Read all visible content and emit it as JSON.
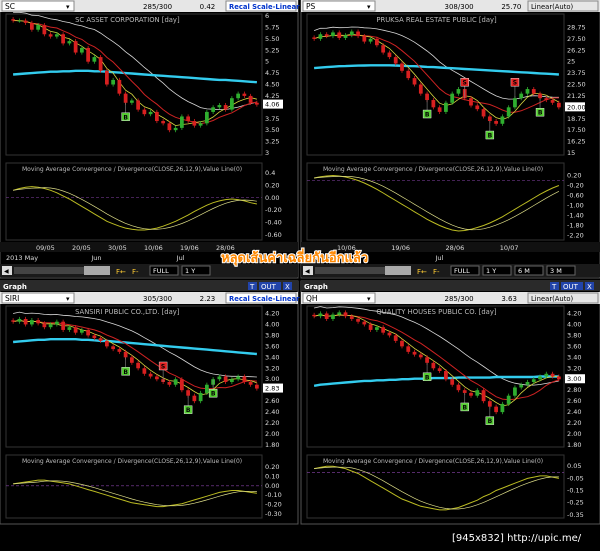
{
  "colors": {
    "background": "#000000",
    "header_bg": "#e6e6e6",
    "title_bar": "#2a2a2a",
    "recal_blue": "#0033cc",
    "grid": "#3a3a3a",
    "ma_slow": "#33ccee",
    "ma_white": "#d8d8d8",
    "ma_red": "#cc2222",
    "ma_yellow": "#d8d840",
    "candle_up": "#2fae2f",
    "candle_down": "#d82020",
    "buy_marker": "#55cc33",
    "sell_marker": "#dd2222",
    "macd_line": "#bbbb22",
    "macd_signal": "#dddd88",
    "overlay_text": "#ff8800"
  },
  "overlay_caption": "หลุดเส้นค่าเฉลี่ยกันอีกแล้ว",
  "footer": "[945x832] http://upic.me/",
  "charts": [
    {
      "symbol": "SC",
      "count": "285/300",
      "last": "0.42",
      "scale_label": "Recal Scale-Linear",
      "title": "SC ASSET CORPORATION [day]",
      "has_graph_bar": false,
      "price_ticks": [
        "6",
        "5.75",
        "5.50",
        "5.25",
        "5",
        "4.75",
        "4.50",
        "4.25",
        "4.06",
        "3.75",
        "3.50",
        "3.25",
        "3"
      ],
      "price_hl": "4.06",
      "macd_label": "Moving Average Convergence / Divergence(CLOSE,26,12,9),Value Line(0)",
      "macd_ticks": [
        "0.4",
        "0.20",
        "0.00",
        "-0.20",
        "-0.40",
        "-0.60"
      ],
      "date_ticks": [
        "09/05",
        "20/05",
        "30/05",
        "10/06",
        "19/06",
        "28/06"
      ],
      "month_labels": [
        "2013 May",
        "Jun",
        "Jul"
      ],
      "nav_buttons": [
        "FULL",
        "1 Y"
      ],
      "markers": [
        {
          "type": "B",
          "text": "B"
        }
      ],
      "chart_data": {
        "type": "line",
        "title": "SC ASSET CORPORATION [day]",
        "ylim": [
          3.0,
          6.0
        ],
        "close": [
          5.9,
          5.9,
          5.85,
          5.7,
          5.8,
          5.6,
          5.55,
          5.6,
          5.4,
          5.45,
          5.2,
          5.3,
          5.0,
          5.1,
          4.8,
          4.5,
          4.6,
          4.3,
          4.1,
          4.15,
          3.95,
          3.85,
          3.9,
          3.7,
          3.65,
          3.5,
          3.55,
          3.8,
          3.7,
          3.6,
          3.65,
          3.9,
          4.0,
          4.05,
          3.95,
          4.2,
          4.3,
          4.25,
          4.1,
          4.06
        ],
        "ma_slow": [
          4.72,
          4.73,
          4.74,
          4.75,
          4.76,
          4.77,
          4.78,
          4.78,
          4.79,
          4.79,
          4.8,
          4.8,
          4.8,
          4.79,
          4.79,
          4.78,
          4.77,
          4.76,
          4.75,
          4.74,
          4.73,
          4.72,
          4.71,
          4.7,
          4.69,
          4.68,
          4.67,
          4.66,
          4.65,
          4.64,
          4.63,
          4.62,
          4.61,
          4.6,
          4.6,
          4.59,
          4.58,
          4.57,
          4.56,
          4.55
        ],
        "macd": [
          0.12,
          0.15,
          0.17,
          0.18,
          0.17,
          0.15,
          0.12,
          0.08,
          0.03,
          -0.02,
          -0.08,
          -0.14,
          -0.2,
          -0.26,
          -0.32,
          -0.38,
          -0.42,
          -0.46,
          -0.49,
          -0.51,
          -0.52,
          -0.52,
          -0.51,
          -0.49,
          -0.46,
          -0.42,
          -0.38,
          -0.33,
          -0.28,
          -0.22,
          -0.17,
          -0.12,
          -0.08,
          -0.05,
          -0.03,
          -0.02,
          -0.03,
          -0.05,
          -0.08,
          -0.1
        ],
        "macd_ylim": [
          -0.65,
          0.4
        ]
      }
    },
    {
      "symbol": "PS",
      "count": "308/300",
      "last": "25.70",
      "scale_label": "Linear(Auto)",
      "title": "PRUKSA REAL ESTATE PUBLIC [day]",
      "has_graph_bar": false,
      "price_ticks": [
        "28.75",
        "27.50",
        "26.25",
        "25",
        "23.75",
        "22.50",
        "21.25",
        "20.00",
        "18.75",
        "17.50",
        "16.25",
        "15"
      ],
      "price_hl": "20.00",
      "macd_label": "Moving Average Convergence / Divergence(CLOSE,26,12,9),Value Line(0)",
      "macd_ticks": [
        "0.20",
        "-0.20",
        "-0.60",
        "-1.00",
        "-1.40",
        "-1.80",
        "-2.20"
      ],
      "date_ticks": [
        "10/06",
        "19/06",
        "28/06",
        "10/07"
      ],
      "month_labels": [
        "Jun",
        "Jul"
      ],
      "nav_buttons": [
        "FULL",
        "1 Y",
        "6 M",
        "3 M"
      ],
      "markers": [
        {
          "type": "B",
          "text": "B"
        },
        {
          "type": "S",
          "text": "S"
        },
        {
          "type": "B",
          "text": "B"
        },
        {
          "type": "S",
          "text": "S"
        },
        {
          "type": "B",
          "text": "B"
        }
      ],
      "chart_data": {
        "type": "line",
        "title": "PRUKSA REAL ESTATE PUBLIC [day]",
        "ylim": [
          15,
          30
        ],
        "close": [
          27.5,
          28,
          27.8,
          28.2,
          27.6,
          27.9,
          28.3,
          27.8,
          27.2,
          27.5,
          26.8,
          26,
          25.5,
          24.8,
          24,
          23.2,
          22.5,
          21.5,
          20.8,
          20,
          19.5,
          20.5,
          21.5,
          22,
          21,
          20.2,
          19.8,
          19,
          18.5,
          18.2,
          19,
          20,
          21,
          21.5,
          22,
          21.5,
          21,
          20.8,
          20.5,
          20
        ],
        "ma_slow": [
          24.3,
          24.35,
          24.4,
          24.45,
          24.5,
          24.52,
          24.55,
          24.57,
          24.58,
          24.6,
          24.6,
          24.6,
          24.6,
          24.58,
          24.55,
          24.52,
          24.5,
          24.47,
          24.43,
          24.4,
          24.36,
          24.32,
          24.28,
          24.24,
          24.2,
          24.16,
          24.12,
          24.08,
          24.04,
          24.0,
          23.96,
          23.92,
          23.88,
          23.84,
          23.8,
          23.76,
          23.72,
          23.68,
          23.64,
          23.6
        ],
        "macd": [
          0.1,
          0.15,
          0.18,
          0.2,
          0.18,
          0.14,
          0.08,
          0.0,
          -0.1,
          -0.22,
          -0.35,
          -0.5,
          -0.65,
          -0.8,
          -0.95,
          -1.1,
          -1.25,
          -1.4,
          -1.55,
          -1.68,
          -1.8,
          -1.9,
          -1.98,
          -2.02,
          -2.0,
          -1.95,
          -1.88,
          -1.8,
          -1.7,
          -1.58,
          -1.45,
          -1.3,
          -1.15,
          -1.0,
          -0.85,
          -0.7,
          -0.55,
          -0.42,
          -0.3,
          -0.2
        ],
        "macd_ylim": [
          -2.3,
          0.3
        ]
      }
    },
    {
      "symbol": "SIRI",
      "count": "305/300",
      "last": "2.23",
      "scale_label": "Recal Scale-Linear",
      "title": "SANSIRI PUBLIC CO.,LTD. [day]",
      "has_graph_bar": true,
      "price_ticks": [
        "4.20",
        "4.00",
        "3.80",
        "3.60",
        "3.40",
        "3.20",
        "3.00",
        "2.83",
        "2.60",
        "2.40",
        "2.20",
        "2.00",
        "1.80"
      ],
      "price_hl": "2.83",
      "macd_label": "Moving Average Convergence / Divergence(CLOSE,26,12,9),Value Line(0)",
      "macd_ticks": [
        "0.20",
        "0.10",
        "0.00",
        "-0.10",
        "-0.20",
        "-0.30"
      ],
      "markers": [
        {
          "type": "B",
          "text": "B"
        },
        {
          "type": "S",
          "text": "S"
        },
        {
          "type": "B",
          "text": "B"
        },
        {
          "type": "B",
          "text": "B"
        }
      ],
      "chart_data": {
        "type": "line",
        "title": "SANSIRI PUBLIC CO.,LTD. [day]",
        "ylim": [
          1.8,
          4.3
        ],
        "close": [
          4.05,
          4.1,
          4.0,
          4.08,
          4.02,
          3.95,
          4.0,
          4.05,
          3.9,
          3.95,
          3.85,
          3.9,
          3.8,
          3.75,
          3.7,
          3.6,
          3.55,
          3.5,
          3.4,
          3.3,
          3.2,
          3.1,
          3.05,
          3.0,
          2.95,
          2.9,
          3.0,
          2.8,
          2.7,
          2.6,
          2.75,
          2.9,
          3.0,
          3.05,
          2.95,
          3.0,
          3.05,
          2.95,
          2.9,
          2.83
        ],
        "ma_slow": [
          3.68,
          3.69,
          3.7,
          3.71,
          3.72,
          3.72,
          3.73,
          3.73,
          3.73,
          3.73,
          3.73,
          3.72,
          3.72,
          3.71,
          3.7,
          3.7,
          3.69,
          3.68,
          3.67,
          3.66,
          3.65,
          3.64,
          3.63,
          3.62,
          3.61,
          3.6,
          3.59,
          3.58,
          3.57,
          3.56,
          3.55,
          3.54,
          3.53,
          3.52,
          3.51,
          3.5,
          3.49,
          3.48,
          3.47,
          3.46
        ],
        "macd": [
          0.02,
          0.03,
          0.04,
          0.05,
          0.06,
          0.06,
          0.05,
          0.04,
          0.03,
          0.02,
          0.0,
          -0.02,
          -0.04,
          -0.06,
          -0.08,
          -0.1,
          -0.12,
          -0.14,
          -0.16,
          -0.18,
          -0.19,
          -0.2,
          -0.21,
          -0.22,
          -0.22,
          -0.21,
          -0.2,
          -0.19,
          -0.17,
          -0.15,
          -0.13,
          -0.11,
          -0.09,
          -0.07,
          -0.06,
          -0.05,
          -0.05,
          -0.06,
          -0.07,
          -0.08
        ],
        "macd_ylim": [
          -0.32,
          0.22
        ]
      }
    },
    {
      "symbol": "QH",
      "count": "285/300",
      "last": "3.63",
      "scale_label": "Linear(Auto)",
      "title": "QUALITY HOUSES PUBLIC CO. [day]",
      "has_graph_bar": true,
      "price_ticks": [
        "4.20",
        "4.00",
        "3.80",
        "3.60",
        "3.40",
        "3.20",
        "3.00",
        "2.80",
        "2.60",
        "2.40",
        "2.20",
        "2.00",
        "1.80"
      ],
      "price_hl": "3.00",
      "macd_label": "Moving Average Convergence / Divergence(CLOSE,26,12,9),Value Line(0)",
      "macd_ticks": [
        "0.05",
        "-0.05",
        "-0.15",
        "-0.25",
        "-0.35"
      ],
      "markers": [
        {
          "type": "B",
          "text": "B"
        },
        {
          "type": "B",
          "text": "B"
        },
        {
          "type": "B",
          "text": "B"
        }
      ],
      "chart_data": {
        "type": "line",
        "title": "QUALITY HOUSES PUBLIC CO. [day]",
        "ylim": [
          1.8,
          4.3
        ],
        "close": [
          4.15,
          4.2,
          4.1,
          4.18,
          4.22,
          4.15,
          4.1,
          4.05,
          4.0,
          3.9,
          3.95,
          3.85,
          3.8,
          3.7,
          3.6,
          3.5,
          3.45,
          3.4,
          3.3,
          3.2,
          3.15,
          3.0,
          2.9,
          2.8,
          2.75,
          2.7,
          2.8,
          2.6,
          2.5,
          2.4,
          2.55,
          2.7,
          2.85,
          2.9,
          2.95,
          3.0,
          3.05,
          3.1,
          3.05,
          3.0
        ],
        "ma_slow": [
          2.88,
          2.9,
          2.91,
          2.92,
          2.93,
          2.94,
          2.95,
          2.96,
          2.97,
          2.97,
          2.98,
          2.98,
          2.99,
          2.99,
          3.0,
          3.0,
          3.01,
          3.01,
          3.01,
          3.02,
          3.02,
          3.02,
          3.02,
          3.03,
          3.03,
          3.03,
          3.03,
          3.03,
          3.03,
          3.04,
          3.04,
          3.04,
          3.04,
          3.04,
          3.04,
          3.04,
          3.05,
          3.05,
          3.05,
          3.05
        ],
        "macd": [
          0.03,
          0.04,
          0.05,
          0.05,
          0.04,
          0.03,
          0.01,
          -0.01,
          -0.04,
          -0.07,
          -0.1,
          -0.13,
          -0.16,
          -0.19,
          -0.22,
          -0.24,
          -0.26,
          -0.28,
          -0.29,
          -0.3,
          -0.31,
          -0.31,
          -0.3,
          -0.29,
          -0.27,
          -0.25,
          -0.23,
          -0.2,
          -0.18,
          -0.15,
          -0.13,
          -0.11,
          -0.09,
          -0.07,
          -0.05,
          -0.04,
          -0.03,
          -0.03,
          -0.04,
          -0.05
        ],
        "macd_ylim": [
          -0.36,
          0.06
        ]
      }
    }
  ]
}
